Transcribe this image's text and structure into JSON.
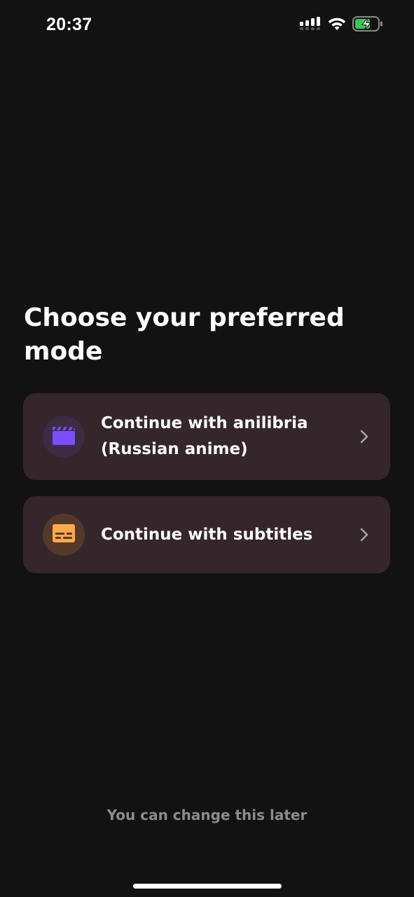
{
  "status_bar": {
    "time": "20:37",
    "icons": [
      "cellular-signal-icon",
      "wifi-icon",
      "battery-charging-icon"
    ]
  },
  "title": "Choose your preferred mode",
  "options": [
    {
      "label": "Continue with anilibria (Russian anime)",
      "icon": "clapperboard-icon",
      "icon_color": "#7c4dff"
    },
    {
      "label": "Continue with subtitles",
      "icon": "subtitles-icon",
      "icon_color": "#ffa94d"
    }
  ],
  "footer_note": "You can change this later",
  "colors": {
    "background": "#121212",
    "card": "#34262a",
    "text": "#ffffff",
    "muted_text": "#8c8c8c",
    "battery": "#34c759"
  }
}
